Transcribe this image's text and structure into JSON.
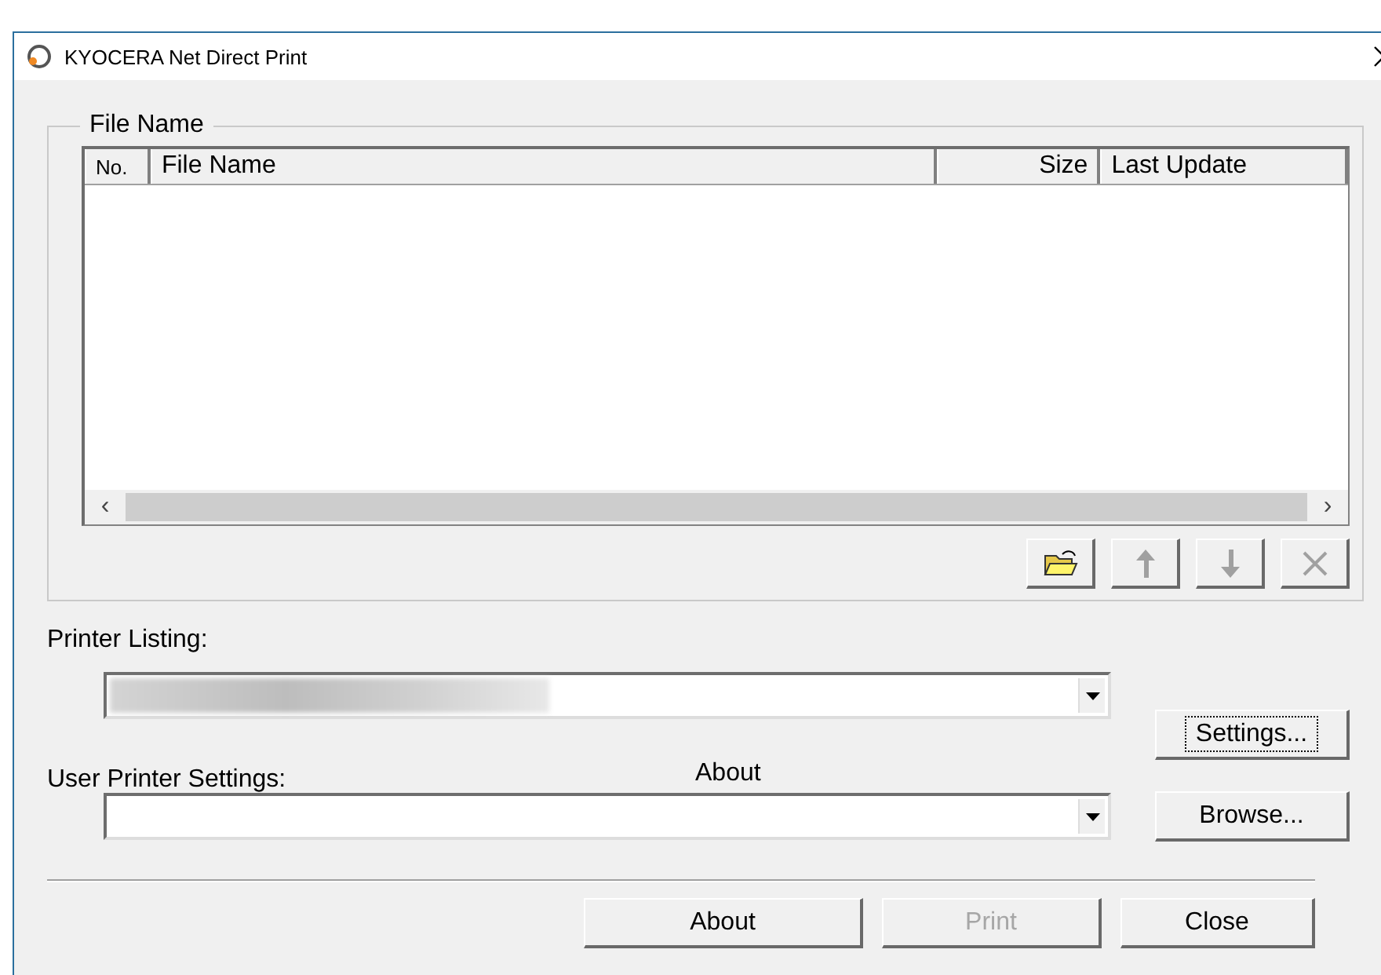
{
  "window": {
    "title": "KYOCERA Net Direct Print"
  },
  "file_group": {
    "legend": "File Name",
    "columns": [
      "No.",
      "File Name",
      "Size",
      "Last Update"
    ],
    "scroll_left": "‹",
    "scroll_right": "›",
    "tools": [
      {
        "kind": "open",
        "disabled": false
      },
      {
        "kind": "up",
        "disabled": true
      },
      {
        "kind": "down",
        "disabled": true
      },
      {
        "kind": "delete",
        "disabled": true
      }
    ]
  },
  "printer_listing": {
    "label": "Printer Listing:",
    "value_redacted": true
  },
  "user_printer_settings": {
    "label": "User Printer Settings:",
    "extra_label": "About"
  },
  "side_buttons": [
    {
      "label": "Settings...",
      "focused": true,
      "disabled": false
    },
    {
      "label": "Browse...",
      "focused": false,
      "disabled": false
    }
  ],
  "buttons": [
    {
      "label": "About",
      "disabled": false
    },
    {
      "label": "Print",
      "disabled": true
    },
    {
      "label": "Close",
      "disabled": false
    }
  ]
}
